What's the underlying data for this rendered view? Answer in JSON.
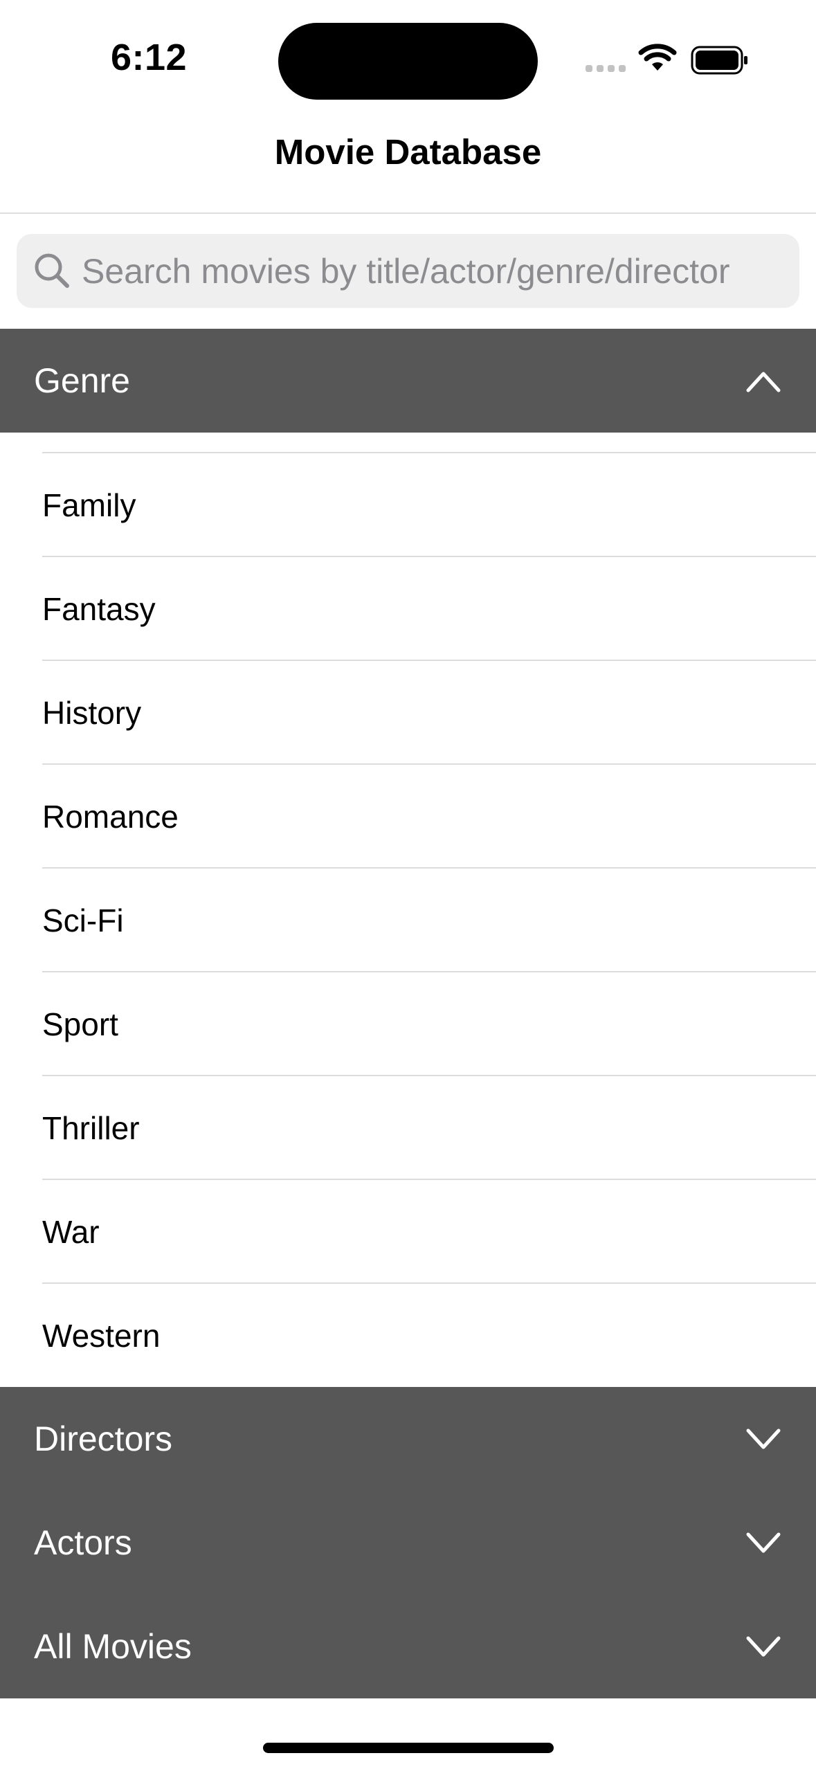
{
  "status_bar": {
    "time": "6:12",
    "icons": [
      "signal-icon",
      "wifi-icon",
      "battery-icon"
    ]
  },
  "nav": {
    "title": "Movie Database"
  },
  "search": {
    "placeholder": "Search movies by title/actor/genre/director",
    "value": "",
    "icon": "search-icon"
  },
  "sections": {
    "genre": {
      "label": "Genre",
      "expanded": true,
      "icon": "chevron-up-icon"
    },
    "directors": {
      "label": "Directors",
      "expanded": false,
      "icon": "chevron-down-icon"
    },
    "actors": {
      "label": "Actors",
      "expanded": false,
      "icon": "chevron-down-icon"
    },
    "all_movies": {
      "label": "All Movies",
      "expanded": false,
      "icon": "chevron-down-icon"
    }
  },
  "genres": [
    "Family",
    "Fantasy",
    "History",
    "Romance",
    "Sci-Fi",
    "Sport",
    "Thriller",
    "War",
    "Western"
  ],
  "colors": {
    "section_header_bg": "#575757",
    "search_bg": "#efefef",
    "placeholder": "#8c8c90"
  }
}
